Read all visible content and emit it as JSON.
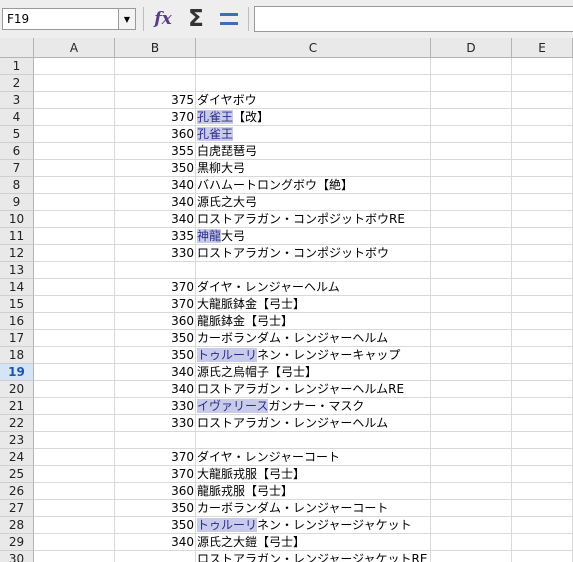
{
  "toolbar": {
    "cell_reference": "F19",
    "formula_value": "",
    "icons": [
      "dropdown-arrow-icon",
      "function-wizard-icon",
      "sum-icon",
      "equals-icon"
    ]
  },
  "columns": [
    "A",
    "B",
    "C",
    "D",
    "E"
  ],
  "active_row": 19,
  "rows": [
    {
      "n": "1",
      "b": "",
      "c": ""
    },
    {
      "n": "2",
      "b": "",
      "c": ""
    },
    {
      "n": "3",
      "b": "375",
      "c": "ダイヤボウ"
    },
    {
      "n": "4",
      "b": "370",
      "c_hl": "孔雀王",
      "c": "【改】"
    },
    {
      "n": "5",
      "b": "360",
      "c_hl": "孔雀王",
      "c": ""
    },
    {
      "n": "6",
      "b": "355",
      "c": "白虎琵琶弓"
    },
    {
      "n": "7",
      "b": "350",
      "c": "黒柳大弓"
    },
    {
      "n": "8",
      "b": "340",
      "c": "バハムートロングボウ【絶】"
    },
    {
      "n": "9",
      "b": "340",
      "c": "源氏之大弓"
    },
    {
      "n": "10",
      "b": "340",
      "c": "ロストアラガン・コンポジットボウRE"
    },
    {
      "n": "11",
      "b": "335",
      "c_hl": "神龍",
      "c": "大弓"
    },
    {
      "n": "12",
      "b": "330",
      "c": "ロストアラガン・コンポジットボウ"
    },
    {
      "n": "13",
      "b": "",
      "c": ""
    },
    {
      "n": "14",
      "b": "370",
      "c": "ダイヤ・レンジャーヘルム"
    },
    {
      "n": "15",
      "b": "370",
      "c": "大龍脈鉢金【弓士】"
    },
    {
      "n": "16",
      "b": "360",
      "c": "龍脈鉢金【弓士】"
    },
    {
      "n": "17",
      "b": "350",
      "c": "カーボランダム・レンジャーヘルム"
    },
    {
      "n": "18",
      "b": "350",
      "c_hl": "トゥルーリ",
      "c": "ネン・レンジャーキャップ"
    },
    {
      "n": "19",
      "b": "340",
      "c": "源氏之烏帽子【弓士】"
    },
    {
      "n": "20",
      "b": "340",
      "c": "ロストアラガン・レンジャーヘルムRE"
    },
    {
      "n": "21",
      "b": "330",
      "c_hl": "イヴァリース",
      "c": "ガンナー・マスク"
    },
    {
      "n": "22",
      "b": "330",
      "c": "ロストアラガン・レンジャーヘルム"
    },
    {
      "n": "23",
      "b": "",
      "c": ""
    },
    {
      "n": "24",
      "b": "370",
      "c": "ダイヤ・レンジャーコート"
    },
    {
      "n": "25",
      "b": "370",
      "c": "大龍脈戎服【弓士】"
    },
    {
      "n": "26",
      "b": "360",
      "c": "龍脈戎服【弓士】"
    },
    {
      "n": "27",
      "b": "350",
      "c": "カーボランダム・レンジャーコート"
    },
    {
      "n": "28",
      "b": "350",
      "c_hl": "トゥルーリ",
      "c": "ネン・レンジャージャケット"
    },
    {
      "n": "29",
      "b": "340",
      "c": "源氏之大鎧【弓士】"
    },
    {
      "n": "30",
      "b": "",
      "c": "ロストアラガン・レンジャージャケットRE"
    }
  ]
}
